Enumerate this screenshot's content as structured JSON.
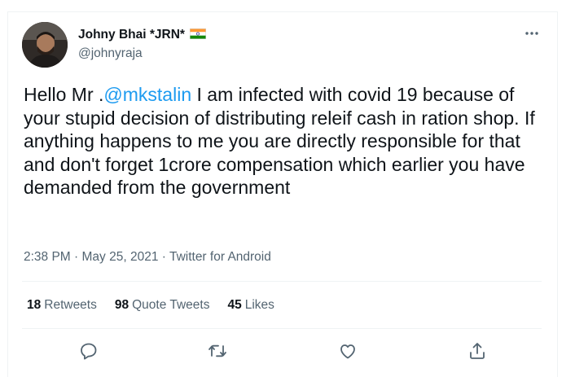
{
  "author": {
    "name": "Johny Bhai *JRN*",
    "handle": "@johnyraja",
    "flag_icon": "india-flag-icon"
  },
  "tweet": {
    "text_before": "Hello Mr .",
    "mention": "@mkstalin",
    "text_after": " I am infected with covid 19 because of your stupid decision of distributing releif cash in ration shop. If anything happens to me you are directly responsible for that and don't forget 1crore compensation which earlier you have demanded from the government",
    "time": "2:38 PM",
    "date": "May 25, 2021",
    "separator": " · ",
    "source": "Twitter for Android"
  },
  "stats": {
    "retweets_count": "18",
    "retweets_label": "Retweets",
    "quotes_count": "98",
    "quotes_label": "Quote Tweets",
    "likes_count": "45",
    "likes_label": "Likes"
  },
  "actions": [
    "reply-icon",
    "retweet-icon",
    "like-icon",
    "share-icon"
  ],
  "colors": {
    "accent": "#1d9bf0",
    "text": "#0f1419",
    "muted": "#536471",
    "border": "#eff3f4"
  }
}
